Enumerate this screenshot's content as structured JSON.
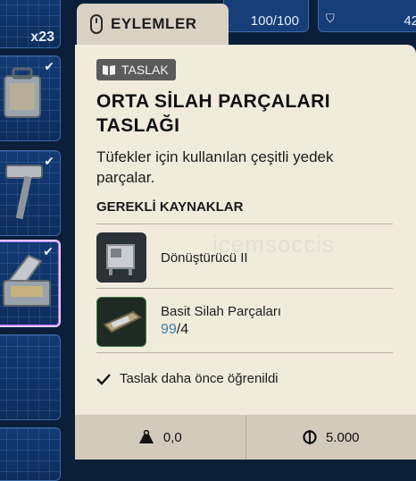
{
  "inventory": {
    "slot1_count": "x23",
    "top_counter": "100/100",
    "top_right_value": "42"
  },
  "actions_tab": {
    "label": "EYLEMLER"
  },
  "tooltip": {
    "badge": "TASLAK",
    "title_line1": "ORTA SİLAH PARÇALARI",
    "title_line2": "TASLAĞI",
    "description_line1": "Tüfekler için kullanılan çeşitli yedek",
    "description_line2": "parçalar.",
    "requirements_heading": "GEREKLİ KAYNAKLAR",
    "resources": [
      {
        "name": "Dönüştürücü II",
        "icon": "converter-machine-icon"
      },
      {
        "name": "Basit Silah Parçaları",
        "have": "99",
        "need": "/4",
        "icon": "weapon-parts-box-icon"
      }
    ],
    "learned_text": "Taslak daha önce öğrenildi",
    "footer": {
      "weight": "0,0",
      "price": "5.000"
    },
    "watermark": "icemsoccis"
  },
  "colors": {
    "panel_bg": "#f1ebdc",
    "footer_bg": "#d2cbbc",
    "have_qty": "#3f7fa6",
    "inventory_bg": "#0b1f3a"
  }
}
